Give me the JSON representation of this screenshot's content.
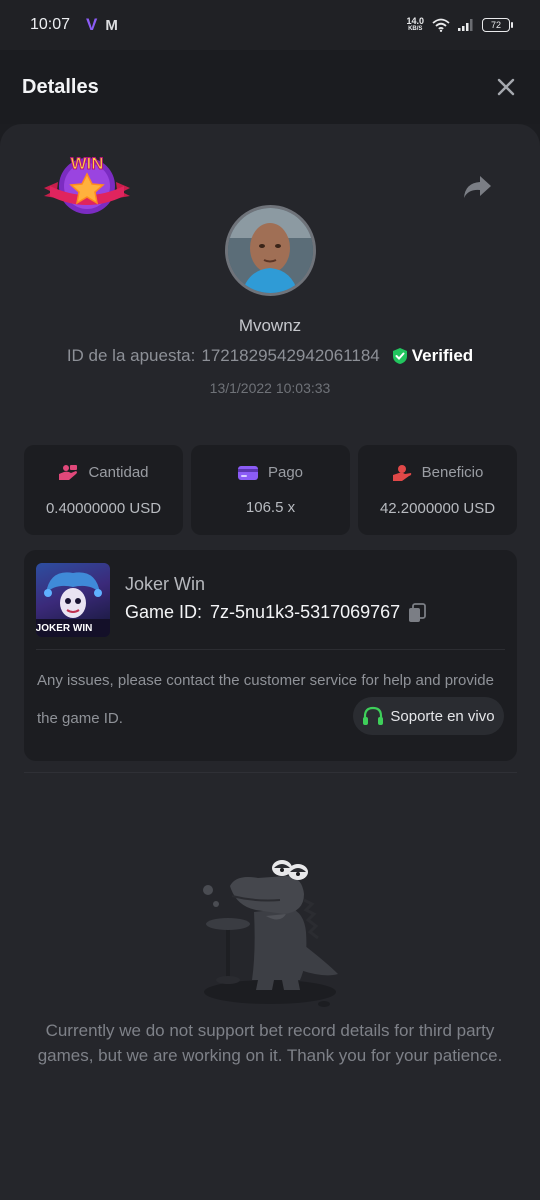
{
  "status_bar": {
    "time": "10:07",
    "app_icon_1": "V",
    "app_icon_2": "M",
    "net_speed_value": "14.0",
    "net_speed_unit": "KB/S",
    "battery": "72"
  },
  "header": {
    "title": "Detalles",
    "close_icon": "close-icon"
  },
  "bet": {
    "badge_text": "WIN",
    "username": "Mvownz",
    "id_label": "ID de la apuesta:",
    "id_value": "1721829542942061184",
    "verified_label": "Verified",
    "timestamp": "13/1/2022 10:03:33"
  },
  "stats": [
    {
      "label": "Cantidad",
      "value": "0.40000000 USD",
      "icon": "money-hand-icon",
      "color": "#e0487a"
    },
    {
      "label": "Pago",
      "value": "106.5 x",
      "icon": "card-icon",
      "color": "#8b5cf6"
    },
    {
      "label": "Beneficio",
      "value": "42.2000000 USD",
      "icon": "profit-hand-icon",
      "color": "#e04848"
    }
  ],
  "game": {
    "name": "Joker Win",
    "id_label": "Game ID:",
    "id_value": "7z-5nu1k3-5317069767",
    "thumb_text": "JOKER WIN",
    "issue_text": "Any issues, please contact the customer service for help and provide the game ID.",
    "support_label": "Soporte en vivo"
  },
  "notice": "Currently we do not support bet record details for third party games, but we are working on it. Thank you for your patience.",
  "colors": {
    "background": "#1c1d21",
    "card": "#25262b",
    "verified_green": "#22c55e",
    "support_green": "#3ecf5a"
  }
}
